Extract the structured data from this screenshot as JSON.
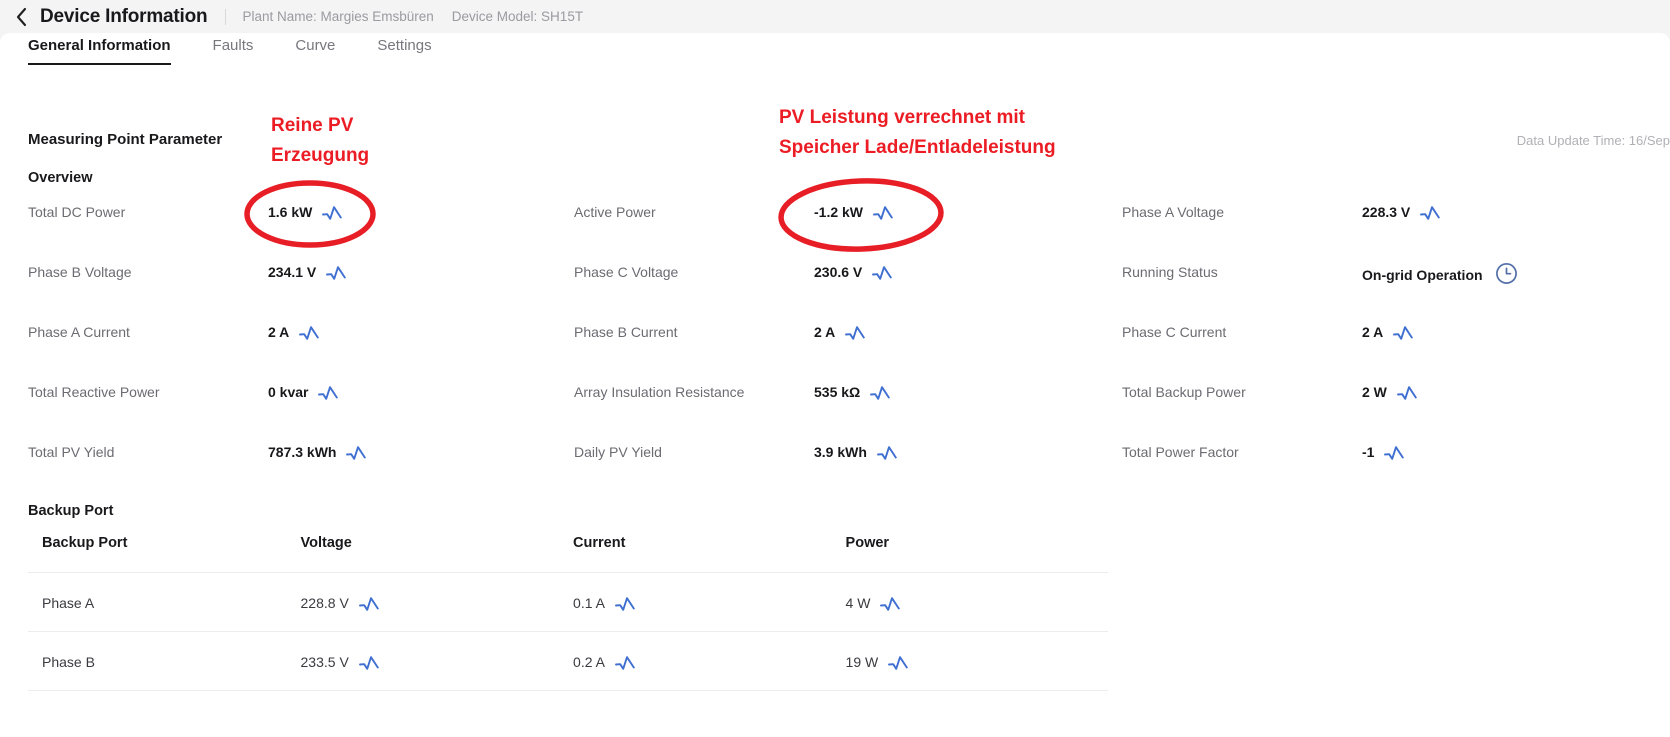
{
  "header": {
    "back_icon": "chevron-left-icon",
    "title": "Device Information",
    "plant_name": "Plant Name: Margies Emsbüren",
    "device_model": "Device Model: SH15T"
  },
  "tabs": [
    {
      "label": "General Information",
      "active": true
    },
    {
      "label": "Faults",
      "active": false
    },
    {
      "label": "Curve",
      "active": false
    },
    {
      "label": "Settings",
      "active": false
    }
  ],
  "main": {
    "measuring_point_parameter": "Measuring Point Parameter",
    "overview_title": "Overview",
    "update_time": "Data Update Time: 16/Sep",
    "backup_port_title": "Backup Port"
  },
  "overview": [
    {
      "label": "Total DC Power",
      "value": "1.6 kW",
      "icon": "trend-chart-icon"
    },
    {
      "label": "Active Power",
      "value": "-1.2 kW",
      "icon": "trend-chart-icon"
    },
    {
      "label": "Phase A Voltage",
      "value": "228.3 V",
      "icon": "trend-chart-icon"
    },
    {
      "label": "Phase B Voltage",
      "value": "234.1 V",
      "icon": "trend-chart-icon"
    },
    {
      "label": "Phase C Voltage",
      "value": "230.6 V",
      "icon": "trend-chart-icon"
    },
    {
      "label": "Running Status",
      "value": "On-grid Operation",
      "icon": "clock-icon"
    },
    {
      "label": "Phase A Current",
      "value": "2 A",
      "icon": "trend-chart-icon"
    },
    {
      "label": "Phase B Current",
      "value": "2 A",
      "icon": "trend-chart-icon"
    },
    {
      "label": "Phase C Current",
      "value": "2 A",
      "icon": "trend-chart-icon"
    },
    {
      "label": "Total Reactive Power",
      "value": "0 kvar",
      "icon": "trend-chart-icon"
    },
    {
      "label": "Array Insulation Resistance",
      "value": "535 kΩ",
      "icon": "trend-chart-icon"
    },
    {
      "label": "Total Backup Power",
      "value": "2 W",
      "icon": "trend-chart-icon"
    },
    {
      "label": "Total PV Yield",
      "value": "787.3 kWh",
      "icon": "trend-chart-icon"
    },
    {
      "label": "Daily PV Yield",
      "value": "3.9 kWh",
      "icon": "trend-chart-icon"
    },
    {
      "label": "Total Power Factor",
      "value": "-1",
      "icon": "trend-chart-icon"
    }
  ],
  "backup_table": {
    "columns": [
      "Backup Port",
      "Voltage",
      "Current",
      "Power"
    ],
    "rows": [
      {
        "port": "Phase A",
        "voltage": "228.8 V",
        "current": "0.1 A",
        "power": "4 W"
      },
      {
        "port": "Phase B",
        "voltage": "233.5 V",
        "current": "0.2 A",
        "power": "19 W"
      }
    ]
  },
  "annotations": [
    {
      "text": "Reine PV\nErzeugung",
      "color": "#ec1c24",
      "target": "Total DC Power"
    },
    {
      "text": "PV Leistung verrechnet mit\nSpeicher Lade/Entladeleistung",
      "color": "#ec1c24",
      "target": "Active Power"
    }
  ],
  "colors": {
    "annotation_red": "#ec1c24",
    "icon_blue": "#3f6fd1",
    "clock_blue": "#5470a8",
    "page_bg": "#f4f4f5",
    "card_bg": "#ffffff"
  }
}
